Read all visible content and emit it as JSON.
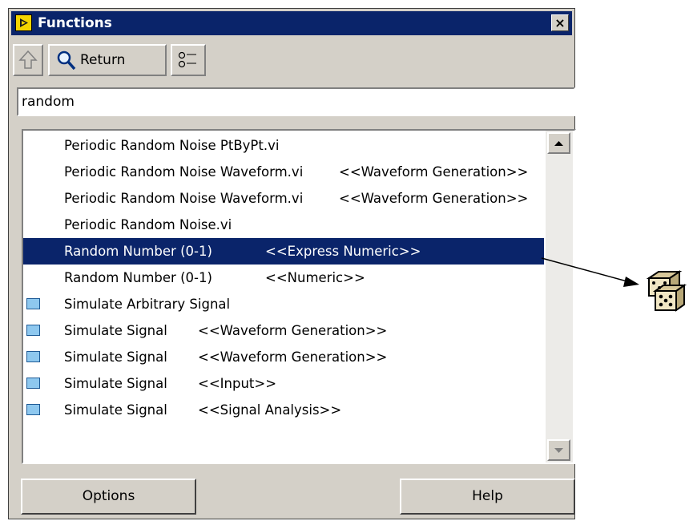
{
  "window": {
    "title": "Functions",
    "close_glyph": "×"
  },
  "toolbar": {
    "return_label": "Return"
  },
  "search": {
    "value": "random"
  },
  "results": [
    {
      "label": "Periodic Random Noise PtByPt.vi",
      "tag": "",
      "icon": "none",
      "selected": false
    },
    {
      "label": "Periodic Random Noise Waveform.vi",
      "tag": "<<Waveform Generation>>",
      "icon": "none",
      "selected": false
    },
    {
      "label": "Periodic Random Noise Waveform.vi",
      "tag": "<<Waveform Generation>>",
      "icon": "none",
      "selected": false
    },
    {
      "label": "Periodic Random Noise.vi",
      "tag": "",
      "icon": "none",
      "selected": false
    },
    {
      "label": "Random Number (0-1)",
      "tag": "<<Express Numeric>>",
      "icon": "none",
      "selected": true
    },
    {
      "label": "Random Number (0-1)",
      "tag": "<<Numeric>>",
      "icon": "none",
      "selected": false
    },
    {
      "label": "Simulate Arbitrary Signal",
      "tag": "",
      "icon": "express-vi-icon",
      "selected": false
    },
    {
      "label": "Simulate Signal",
      "tag": "<<Waveform Generation>>",
      "icon": "express-vi-icon",
      "selected": false
    },
    {
      "label": "Simulate Signal",
      "tag": "<<Waveform Generation>>",
      "icon": "express-vi-icon",
      "selected": false
    },
    {
      "label": "Simulate Signal",
      "tag": "<<Input>>",
      "icon": "express-vi-icon",
      "selected": false
    },
    {
      "label": "Simulate Signal",
      "tag": "<<Signal Analysis>>",
      "icon": "express-vi-icon",
      "selected": false
    }
  ],
  "buttons": {
    "options": "Options",
    "help": "Help"
  },
  "colors": {
    "title_bar": "#0a246a",
    "selection": "#0a246a",
    "panel": "#d4d0c8"
  }
}
